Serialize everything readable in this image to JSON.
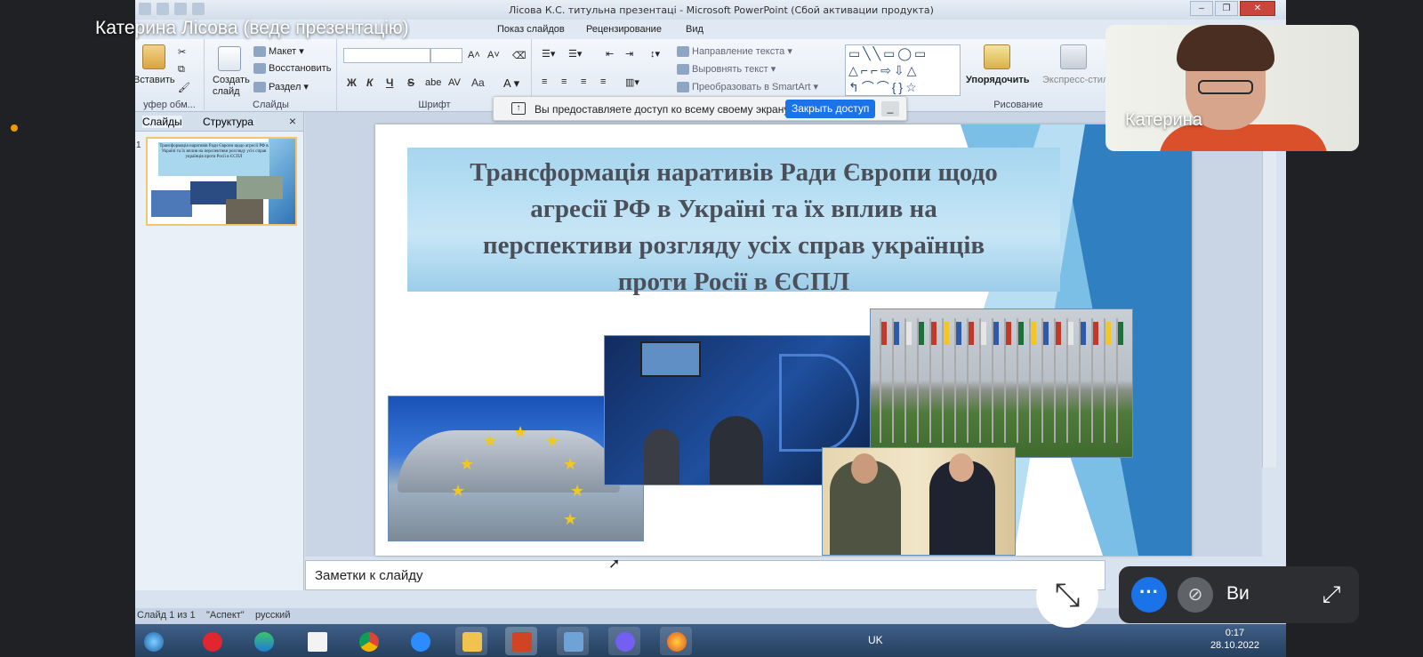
{
  "meet": {
    "presenter_label": "Катерина Лісова (веде презентацію)",
    "self_tile_name": "Катерина",
    "pip_label": "Ви",
    "more_icon": "more-horiz-icon",
    "camera_off_icon": "videocam-off-icon",
    "expand_icon": "open-in-full-icon",
    "exit_fullscreen_icon": "fullscreen-exit-icon",
    "accent_color": "#1a73e8"
  },
  "window": {
    "title": "Лісова К.С. титульна презентаці  -  Microsoft PowerPoint (Сбой активации продукта)"
  },
  "ribbon_tabs": [
    "Показ слайдов",
    "Рецензирование",
    "Вид"
  ],
  "ribbon": {
    "clipboard": {
      "paste": "Вставить",
      "group": "уфер обм..."
    },
    "slides": {
      "new_slide": "Создать слайд",
      "layout": "Макет",
      "reset": "Восстановить",
      "section": "Раздел",
      "group": "Слайды"
    },
    "font": {
      "group": "Шрифт",
      "bold": "Ж",
      "italic": "К",
      "underline": "Ч",
      "strike": "S",
      "case": "Aa"
    },
    "paragraph": {
      "text_direction": "Направление текста",
      "align_text": "Выровнять текст",
      "smartart": "Преобразовать в SmartArt"
    },
    "drawing": {
      "arrange": "Упорядочить",
      "quick_styles": "Экспресс-стили",
      "group": "Рисование"
    }
  },
  "share_bar": {
    "message": "Вы предоставляете доступ ко всему своему экрану.",
    "stop_button": "Закрыть доступ",
    "minimize": "_"
  },
  "pane": {
    "tab_slides": "Слайды",
    "tab_outline": "Структура",
    "close": "×",
    "slide_number": "1",
    "thumb_title": "Трансформація наративів Ради Європи щодо агресії РФ в Україні та їх вплив на перспективи розгляду усіх справ українців проти Росії в ЄСПЛ"
  },
  "slide": {
    "title_lines": [
      "Трансформація наративів Ради Європи щодо",
      "агресії РФ в Україні та їх вплив на",
      "перспективи розгляду усіх справ українців",
      "проти Росії в ЄСПЛ"
    ]
  },
  "notes": {
    "placeholder": "Заметки к слайду"
  },
  "status": {
    "slide_of": "Слайд 1 из 1",
    "theme": "\"Аспект\"",
    "language": "русский"
  },
  "tray": {
    "lang": "UK",
    "time": "0:17",
    "date": "28.10.2022"
  }
}
